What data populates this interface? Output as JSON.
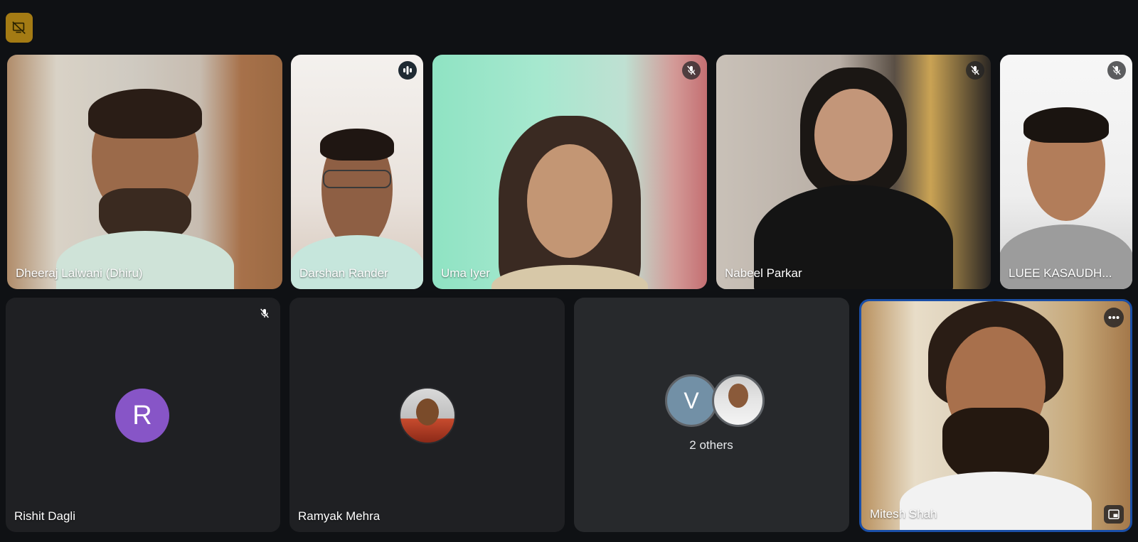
{
  "toolbar": {
    "badge_icon": "no-screen-share-icon",
    "badge_color": "#a47b14"
  },
  "participants": [
    {
      "name": "Dheeraj Lalwani (Dhiru)",
      "mic": "none"
    },
    {
      "name": "Darshan Rander",
      "mic": "speaking"
    },
    {
      "name": "Uma Iyer",
      "mic": "muted"
    },
    {
      "name": "Nabeel Parkar",
      "mic": "muted"
    },
    {
      "name": "LUEE KASAUDH...",
      "mic": "muted"
    },
    {
      "name": "Rishit Dagli",
      "mic": "muted",
      "avatar_letter": "R",
      "avatar_color": "#8755c7"
    },
    {
      "name": "Ramyak Mehra",
      "mic": "none"
    },
    {
      "name": "Mitesh Shah",
      "mic": "none",
      "self": true
    }
  ],
  "others": {
    "label": "2 others",
    "avatar_letter": "V",
    "avatar_color": "#7290a6"
  },
  "colors": {
    "background": "#0f1114",
    "tile": "#202124",
    "self_border": "#1a4fa8"
  }
}
